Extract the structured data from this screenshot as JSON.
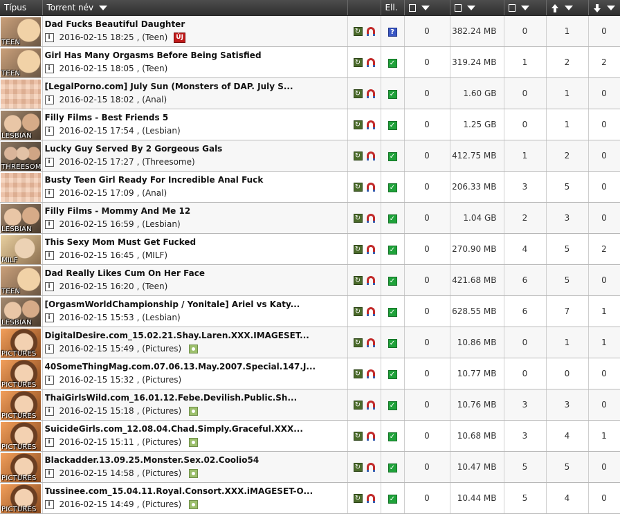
{
  "header": {
    "type_col": "Típus",
    "name_col": "Torrent név",
    "ell_col": "Ell."
  },
  "icons": {
    "comments": "comment-icon",
    "size": "file-size-icon",
    "downloads": "completed-icon",
    "seeders": "arrow-up-icon",
    "leechers": "arrow-down-icon"
  },
  "colors": {
    "header_bg": "#3a3a3a",
    "check_green": "#1fa23a",
    "unknown_blue": "#3a57c4",
    "new_red": "#c01b1b"
  },
  "rows": [
    {
      "category": "TEEN",
      "thumb": "teen",
      "title": "Dad Fucks Beautiful Daughter",
      "date": "2016-02-15 18:25",
      "cat_text": ", (Teen)",
      "badge": "ÚJ",
      "pic": false,
      "status": "unknown",
      "comments": "0",
      "size": "382.24 MB",
      "downloads": "0",
      "seeders": "1",
      "leechers": "0"
    },
    {
      "category": "TEEN",
      "thumb": "teen",
      "title": "Girl Has Many Orgasms Before Being Satisfied",
      "date": "2016-02-15 18:05",
      "cat_text": ", (Teen)",
      "badge": "",
      "pic": false,
      "status": "checked",
      "comments": "0",
      "size": "319.24 MB",
      "downloads": "1",
      "seeders": "2",
      "leechers": "2"
    },
    {
      "category": "",
      "thumb": "anal",
      "title": "[LegalPorno.com] July Sun (Monsters of DAP. July S...",
      "date": "2016-02-15 18:02",
      "cat_text": ", (Anal)",
      "badge": "",
      "pic": false,
      "status": "checked",
      "comments": "0",
      "size": "1.60 GB",
      "downloads": "0",
      "seeders": "1",
      "leechers": "0"
    },
    {
      "category": "LESBIAN",
      "thumb": "lesbian",
      "title": "Filly Films - Best Friends 5",
      "date": "2016-02-15 17:54",
      "cat_text": ", (Lesbian)",
      "badge": "",
      "pic": false,
      "status": "checked",
      "comments": "0",
      "size": "1.25 GB",
      "downloads": "0",
      "seeders": "1",
      "leechers": "0"
    },
    {
      "category": "THREESOME",
      "thumb": "threesome",
      "title": "Lucky Guy Served By 2 Gorgeous Gals",
      "date": "2016-02-15 17:27",
      "cat_text": ", (Threesome)",
      "badge": "",
      "pic": false,
      "status": "checked",
      "comments": "0",
      "size": "412.75 MB",
      "downloads": "1",
      "seeders": "2",
      "leechers": "0"
    },
    {
      "category": "",
      "thumb": "anal",
      "title": "Busty Teen Girl Ready For Incredible Anal Fuck",
      "date": "2016-02-15 17:09",
      "cat_text": ", (Anal)",
      "badge": "",
      "pic": false,
      "status": "checked",
      "comments": "0",
      "size": "206.33 MB",
      "downloads": "3",
      "seeders": "5",
      "leechers": "0"
    },
    {
      "category": "LESBIAN",
      "thumb": "lesbian",
      "title": "Filly Films - Mommy And Me 12",
      "date": "2016-02-15 16:59",
      "cat_text": ", (Lesbian)",
      "badge": "",
      "pic": false,
      "status": "checked",
      "comments": "0",
      "size": "1.04 GB",
      "downloads": "2",
      "seeders": "3",
      "leechers": "0"
    },
    {
      "category": "MILF",
      "thumb": "milf",
      "title": "This Sexy Mom Must Get Fucked",
      "date": "2016-02-15 16:45",
      "cat_text": ", (MILF)",
      "badge": "",
      "pic": false,
      "status": "checked",
      "comments": "0",
      "size": "270.90 MB",
      "downloads": "4",
      "seeders": "5",
      "leechers": "2"
    },
    {
      "category": "TEEN",
      "thumb": "teen",
      "title": "Dad Really Likes Cum On Her Face",
      "date": "2016-02-15 16:20",
      "cat_text": ", (Teen)",
      "badge": "",
      "pic": false,
      "status": "checked",
      "comments": "0",
      "size": "421.68 MB",
      "downloads": "6",
      "seeders": "5",
      "leechers": "0"
    },
    {
      "category": "LESBIAN",
      "thumb": "lesbian",
      "title": "[OrgasmWorldChampionship / Yonitale] Ariel vs Katy...",
      "date": "2016-02-15 15:53",
      "cat_text": ", (Lesbian)",
      "badge": "",
      "pic": false,
      "status": "checked",
      "comments": "0",
      "size": "628.55 MB",
      "downloads": "6",
      "seeders": "7",
      "leechers": "1"
    },
    {
      "category": "PICTURES",
      "thumb": "pictures",
      "title": "DigitalDesire.com_15.02.21.Shay.Laren.XXX.IMAGESET...",
      "date": "2016-02-15 15:49",
      "cat_text": ", (Pictures)",
      "badge": "",
      "pic": true,
      "status": "checked",
      "comments": "0",
      "size": "10.86 MB",
      "downloads": "0",
      "seeders": "1",
      "leechers": "1"
    },
    {
      "category": "PICTURES",
      "thumb": "pictures",
      "title": "40SomeThingMag.com.07.06.13.May.2007.Special.147.J...",
      "date": "2016-02-15 15:32",
      "cat_text": ", (Pictures)",
      "badge": "",
      "pic": false,
      "status": "checked",
      "comments": "0",
      "size": "10.77 MB",
      "downloads": "0",
      "seeders": "0",
      "leechers": "0"
    },
    {
      "category": "PICTURES",
      "thumb": "pictures",
      "title": "ThaiGirlsWild.com_16.01.12.Febe.Devilish.Public.Sh...",
      "date": "2016-02-15 15:18",
      "cat_text": ", (Pictures)",
      "badge": "",
      "pic": true,
      "status": "checked",
      "comments": "0",
      "size": "10.76 MB",
      "downloads": "3",
      "seeders": "3",
      "leechers": "0"
    },
    {
      "category": "PICTURES",
      "thumb": "pictures",
      "title": "SuicideGirls.com_12.08.04.Chad.Simply.Graceful.XXX...",
      "date": "2016-02-15 15:11",
      "cat_text": ", (Pictures)",
      "badge": "",
      "pic": true,
      "status": "checked",
      "comments": "0",
      "size": "10.68 MB",
      "downloads": "3",
      "seeders": "4",
      "leechers": "1"
    },
    {
      "category": "PICTURES",
      "thumb": "pictures",
      "title": "Blackadder.13.09.25.Monster.Sex.02.Coolio54",
      "date": "2016-02-15 14:58",
      "cat_text": ", (Pictures)",
      "badge": "",
      "pic": true,
      "status": "checked",
      "comments": "0",
      "size": "10.47 MB",
      "downloads": "5",
      "seeders": "5",
      "leechers": "0"
    },
    {
      "category": "PICTURES",
      "thumb": "pictures",
      "title": "Tussinee.com_15.04.11.Royal.Consort.XXX.iMAGESET-O...",
      "date": "2016-02-15 14:49",
      "cat_text": ", (Pictures)",
      "badge": "",
      "pic": true,
      "status": "checked",
      "comments": "0",
      "size": "10.44 MB",
      "downloads": "5",
      "seeders": "4",
      "leechers": "0"
    }
  ]
}
